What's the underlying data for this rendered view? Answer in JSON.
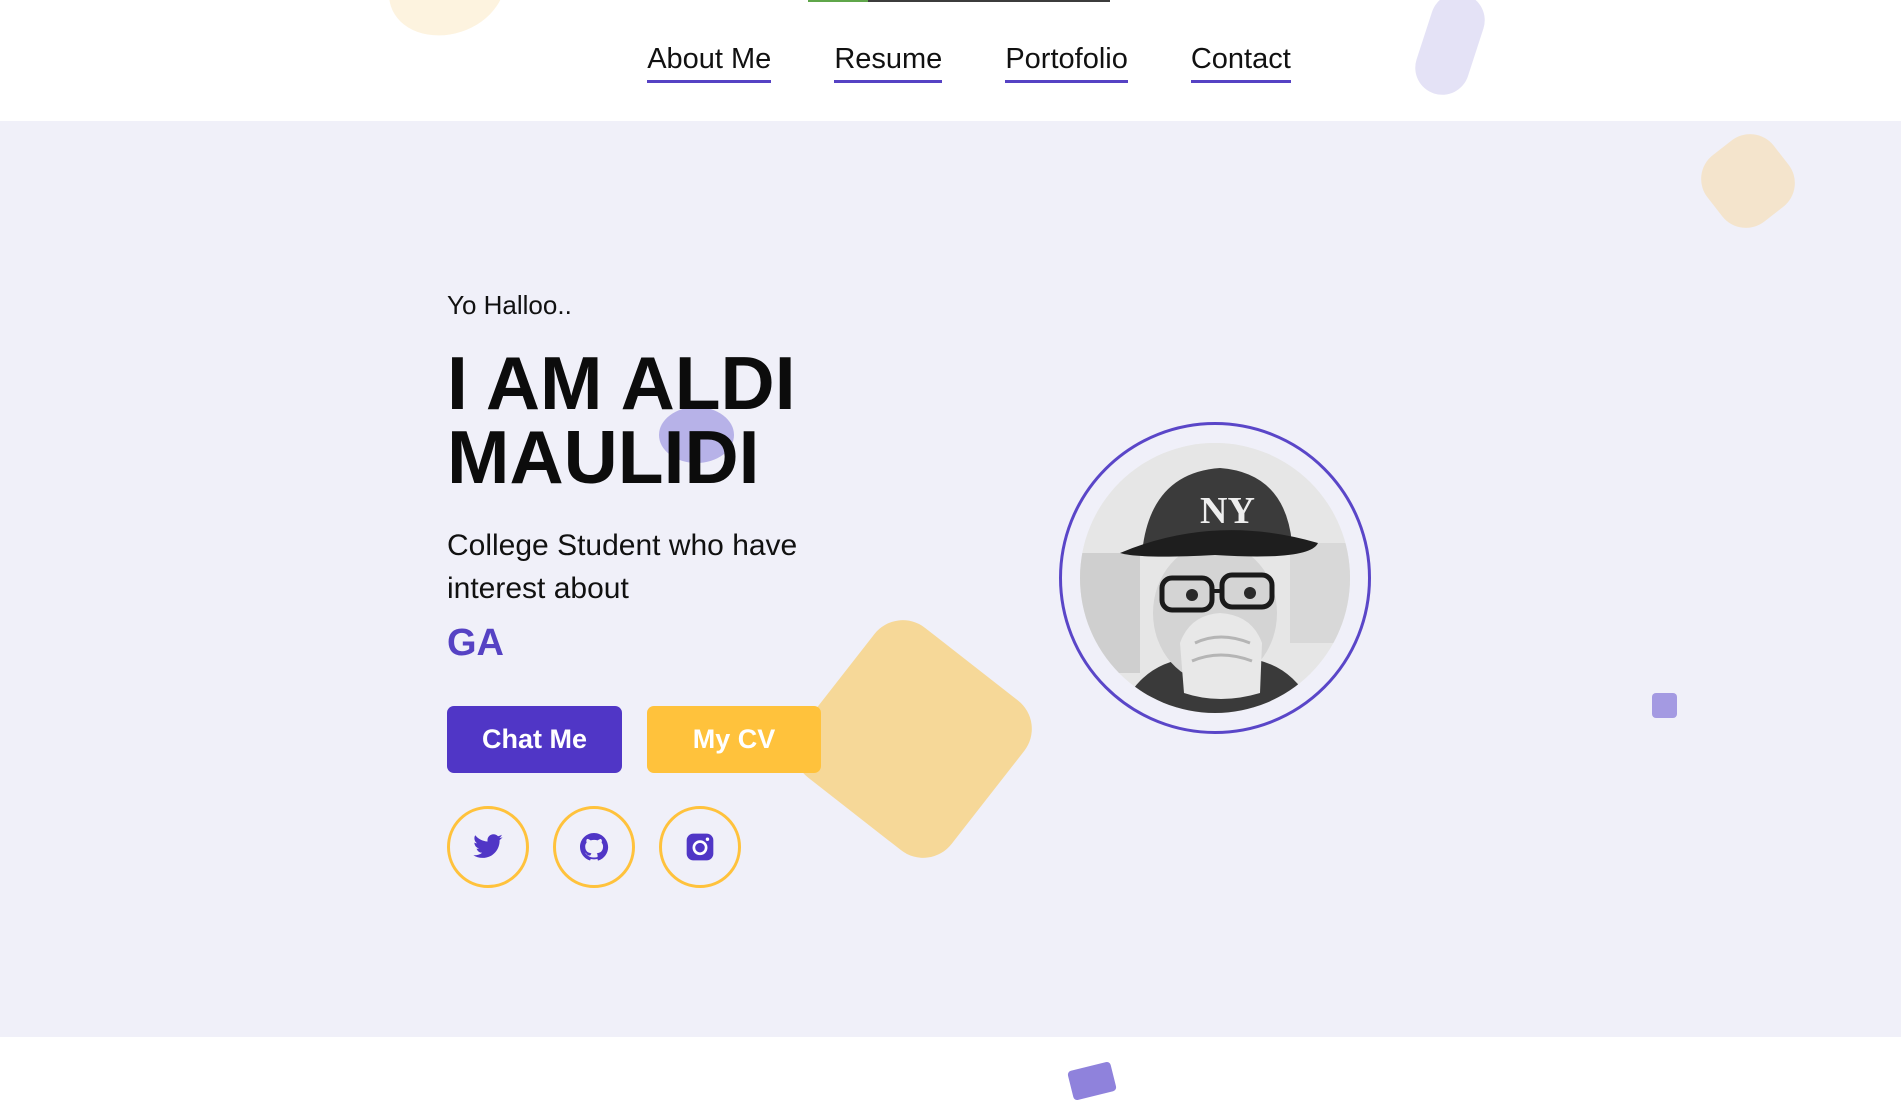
{
  "nav": {
    "items": [
      {
        "label": "About Me"
      },
      {
        "label": "Resume"
      },
      {
        "label": "Portofolio"
      },
      {
        "label": "Contact"
      }
    ]
  },
  "hero": {
    "greeting": "Yo Halloo..",
    "title": "I AM ALDI MAULIDI",
    "subtitle": "College Student who have interest about",
    "typed_text": "GA",
    "chat_button": "Chat Me",
    "cv_button": "My CV"
  },
  "social": [
    {
      "icon": "twitter-icon"
    },
    {
      "icon": "github-icon"
    },
    {
      "icon": "instagram-icon"
    }
  ],
  "colors": {
    "accent": "#5036c6",
    "accent_secondary": "#ffc23c",
    "hero_background": "#f0f0f9",
    "nav_underline": "#5642c4"
  }
}
